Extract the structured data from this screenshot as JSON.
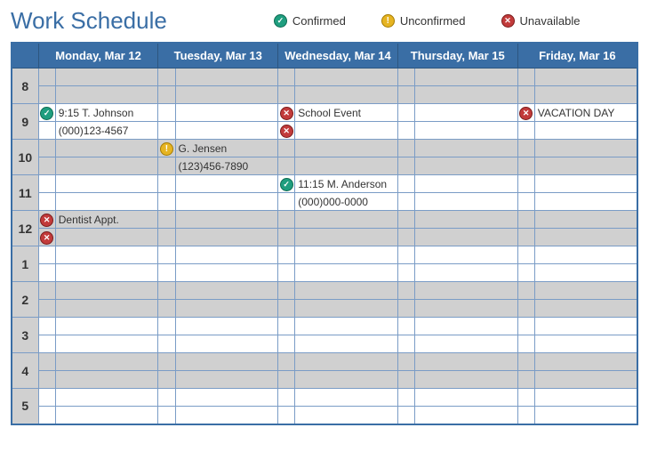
{
  "title": "Work Schedule",
  "legend": {
    "confirmed": "Confirmed",
    "unconfirmed": "Unconfirmed",
    "unavailable": "Unavailable"
  },
  "days": {
    "mon": "Monday, Mar 12",
    "tue": "Tuesday, Mar 13",
    "wed": "Wednesday, Mar 14",
    "thu": "Thursday, Mar 15",
    "fri": "Friday, Mar 16"
  },
  "hours": {
    "h8": "8",
    "h9": "9",
    "h10": "10",
    "h11": "11",
    "h12": "12",
    "h1": "1",
    "h2": "2",
    "h3": "3",
    "h4": "4",
    "h5": "5"
  },
  "events": {
    "mon_9a": "9:15 T. Johnson",
    "mon_9b": "(000)123-4567",
    "mon_12a": "Dentist Appt.",
    "tue_10a": "G. Jensen",
    "tue_10b": "(123)456-7890",
    "wed_9a": "School Event",
    "wed_11a": "11:15 M. Anderson",
    "wed_11b": "(000)000-0000",
    "fri_9a": "VACATION DAY"
  }
}
